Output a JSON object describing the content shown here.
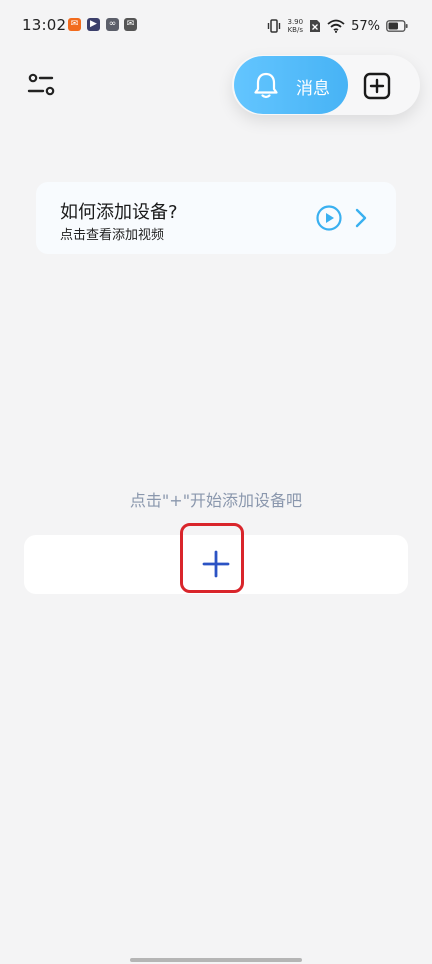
{
  "status_bar": {
    "time": "13:02",
    "net_speed_value": "3.90",
    "net_speed_unit": "KB/s",
    "battery": "57%",
    "app_icons": [
      "notification-app-icon",
      "play-app-icon",
      "link-app-icon",
      "mail-app-icon"
    ]
  },
  "header": {
    "messages_label": "消息"
  },
  "help_card": {
    "title": "如何添加设备?",
    "subtitle": "点击查看添加视频"
  },
  "empty_state": {
    "hint": "点击\"+\"开始添加设备吧"
  },
  "colors": {
    "accent": "#47b3f5",
    "accent_light": "#63c5ff",
    "add_plus": "#2b53c4",
    "highlight": "#d9252b",
    "hint_text": "#8a97ad"
  }
}
